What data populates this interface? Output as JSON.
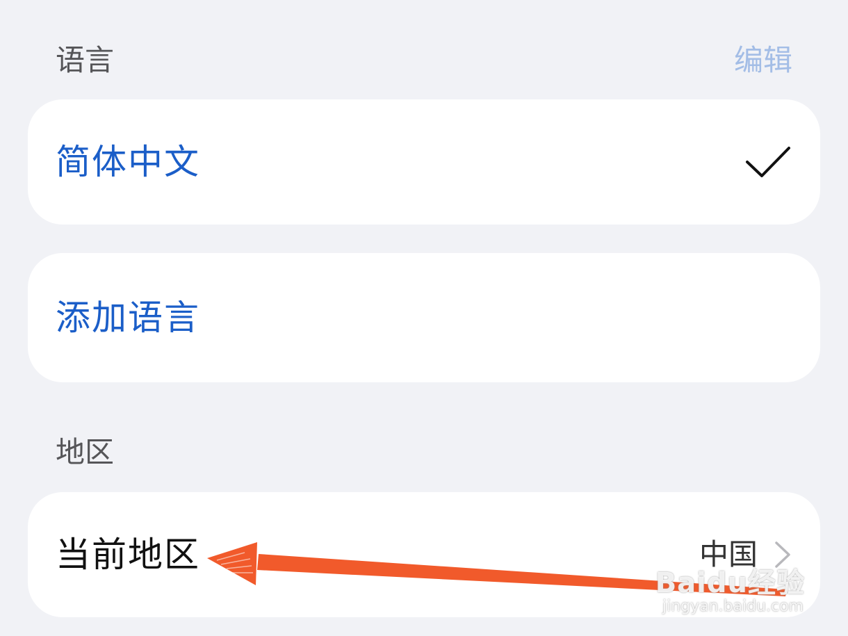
{
  "language_section": {
    "header": "语言",
    "edit_label": "编辑",
    "items": [
      {
        "label": "简体中文",
        "selected": true
      },
      {
        "label": "添加语言"
      }
    ]
  },
  "region_section": {
    "header": "地区",
    "current_label": "当前地区",
    "current_value": "中国"
  },
  "watermark": {
    "brand": "Baidu经验",
    "url": "jingyan.baidu.com"
  },
  "colors": {
    "background": "#f1f2f6",
    "card": "#ffffff",
    "accent_blue": "#1b5ec8",
    "edit_link": "#a3bde6",
    "annotation_arrow": "#f15a2b"
  },
  "icons": {
    "check": "checkmark-icon",
    "chevron": "chevron-right-icon"
  }
}
